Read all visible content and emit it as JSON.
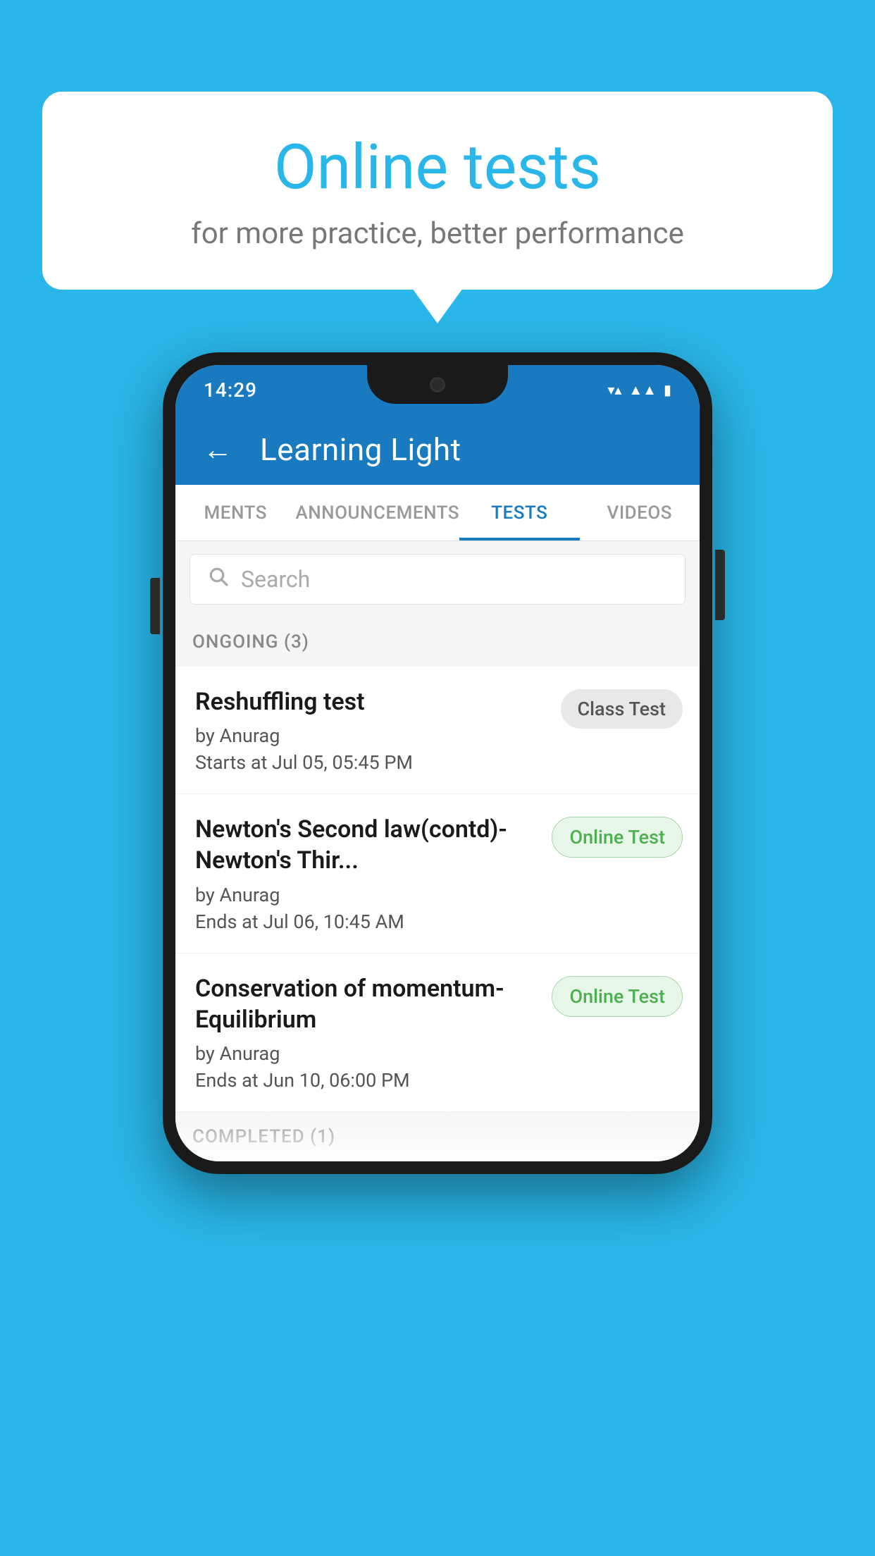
{
  "background_color": "#29b6e8",
  "speech_bubble": {
    "title": "Online tests",
    "subtitle": "for more practice, better performance"
  },
  "phone": {
    "status_bar": {
      "time": "14:29",
      "icons": [
        "wifi",
        "signal",
        "battery"
      ]
    },
    "app_bar": {
      "back_label": "←",
      "title": "Learning Light"
    },
    "tabs": [
      {
        "label": "MENTS",
        "active": false
      },
      {
        "label": "ANNOUNCEMENTS",
        "active": false
      },
      {
        "label": "TESTS",
        "active": true
      },
      {
        "label": "VIDEOS",
        "active": false
      }
    ],
    "search": {
      "placeholder": "Search"
    },
    "sections": [
      {
        "header": "ONGOING (3)",
        "items": [
          {
            "title": "Reshuffling test",
            "author": "by Anurag",
            "date": "Starts at  Jul 05, 05:45 PM",
            "badge": "Class Test",
            "badge_type": "class"
          },
          {
            "title": "Newton's Second law(contd)-Newton's Thir...",
            "author": "by Anurag",
            "date": "Ends at  Jul 06, 10:45 AM",
            "badge": "Online Test",
            "badge_type": "online"
          },
          {
            "title": "Conservation of momentum-Equilibrium",
            "author": "by Anurag",
            "date": "Ends at  Jun 10, 06:00 PM",
            "badge": "Online Test",
            "badge_type": "online"
          }
        ]
      }
    ],
    "completed_header": "COMPLETED (1)"
  }
}
